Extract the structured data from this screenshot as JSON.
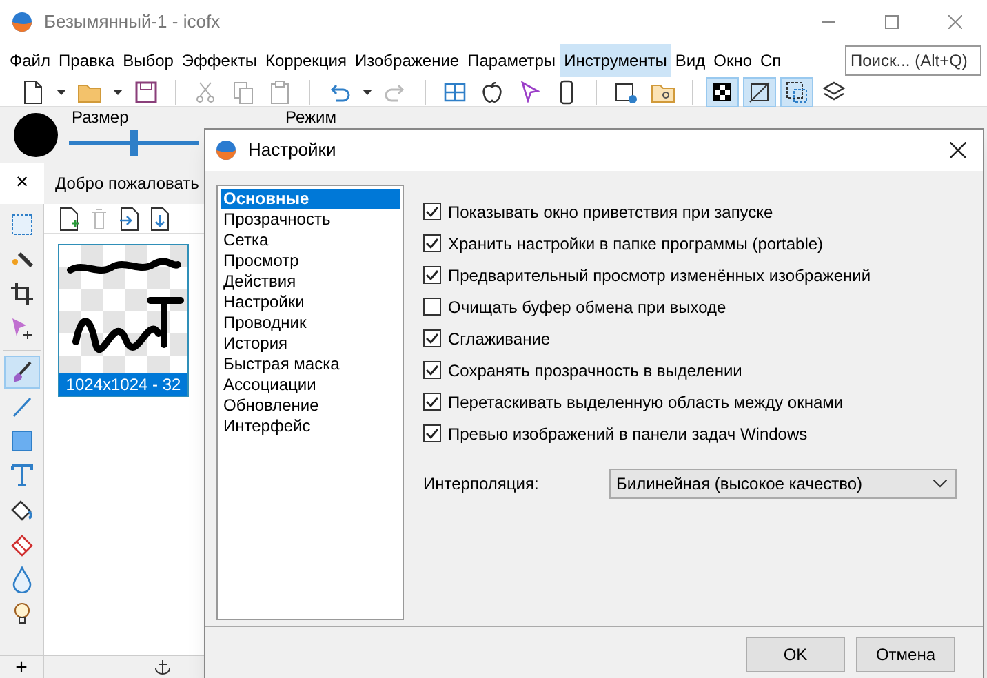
{
  "window": {
    "title": "Безымянный-1 - icofx"
  },
  "menu": [
    {
      "label": "Файл",
      "selected": false
    },
    {
      "label": "Правка",
      "selected": false
    },
    {
      "label": "Выбор",
      "selected": false
    },
    {
      "label": "Эффекты",
      "selected": false
    },
    {
      "label": "Коррекция",
      "selected": false
    },
    {
      "label": "Изображение",
      "selected": false
    },
    {
      "label": "Параметры",
      "selected": false
    },
    {
      "label": "Инструменты",
      "selected": true
    },
    {
      "label": "Вид",
      "selected": false
    },
    {
      "label": "Окно",
      "selected": false
    },
    {
      "label": "Сп",
      "selected": false
    }
  ],
  "search": {
    "placeholder": "Поиск... (Alt+Q)"
  },
  "toolbar": [
    {
      "buttons": [
        {
          "kind": "new",
          "on": false
        },
        {
          "kind": "caret",
          "on": false
        },
        {
          "kind": "open",
          "on": false
        },
        {
          "kind": "caret",
          "on": false
        },
        {
          "kind": "save",
          "on": false
        }
      ]
    },
    {
      "buttons": [
        {
          "kind": "cut",
          "on": false
        },
        {
          "kind": "copy",
          "on": false
        },
        {
          "kind": "paste",
          "on": false
        }
      ]
    },
    {
      "buttons": [
        {
          "kind": "undo",
          "on": false
        },
        {
          "kind": "caret",
          "on": false
        },
        {
          "kind": "redo",
          "on": false
        }
      ]
    },
    {
      "buttons": [
        {
          "kind": "windows",
          "on": false
        },
        {
          "kind": "apple",
          "on": false
        },
        {
          "kind": "cursor",
          "on": false
        },
        {
          "kind": "phone",
          "on": false
        }
      ]
    },
    {
      "buttons": [
        {
          "kind": "newdoc",
          "on": false
        },
        {
          "kind": "browse",
          "on": false
        }
      ]
    },
    {
      "buttons": [
        {
          "kind": "checker",
          "on": true
        },
        {
          "kind": "nocolor",
          "on": true
        },
        {
          "kind": "selection",
          "on": true
        },
        {
          "kind": "layers",
          "on": false
        }
      ]
    }
  ],
  "options": {
    "size_label": "Размер",
    "mode_label": "Режим",
    "size_slider": {
      "level": 0.5
    }
  },
  "tools": [
    {
      "buttons": [
        {
          "kind": "select",
          "selected": false
        },
        {
          "kind": "wand",
          "selected": false
        },
        {
          "kind": "crop",
          "selected": false
        },
        {
          "kind": "move",
          "selected": false
        }
      ]
    },
    {
      "buttons": [
        {
          "kind": "brush",
          "selected": true
        },
        {
          "kind": "line",
          "selected": false
        },
        {
          "kind": "rect",
          "selected": false
        },
        {
          "kind": "text",
          "selected": false
        },
        {
          "kind": "fill",
          "selected": false
        },
        {
          "kind": "eraser",
          "selected": false
        },
        {
          "kind": "drop",
          "selected": false
        },
        {
          "kind": "bulb",
          "selected": false
        }
      ]
    }
  ],
  "document_tab": {
    "close": "×",
    "label": "Добро пожаловать"
  },
  "documents": [
    {
      "caption": "1024x1024 - 32",
      "selected": true
    }
  ],
  "status_bar": {
    "add": "+"
  },
  "dialog": {
    "title": "Настройки",
    "categories": [
      {
        "label": "Основные",
        "selected": true
      },
      {
        "label": "Прозрачность",
        "selected": false
      },
      {
        "label": "Сетка",
        "selected": false
      },
      {
        "label": "Просмотр",
        "selected": false
      },
      {
        "label": "Действия",
        "selected": false
      },
      {
        "label": "Настройки",
        "selected": false
      },
      {
        "label": "Проводник",
        "selected": false
      },
      {
        "label": "История",
        "selected": false
      },
      {
        "label": "Быстрая маска",
        "selected": false
      },
      {
        "label": "Ассоциации",
        "selected": false
      },
      {
        "label": "Обновление",
        "selected": false
      },
      {
        "label": "Интерфейс",
        "selected": false
      }
    ],
    "options": [
      {
        "label": "Показывать окно приветствия при запуске",
        "checked": true
      },
      {
        "label": "Хранить настройки в папке программы (portable)",
        "checked": true
      },
      {
        "label": "Предварительный просмотр изменённых изображений",
        "checked": true
      },
      {
        "label": "Очищать буфер обмена при выходе",
        "checked": false
      },
      {
        "label": "Сглаживание",
        "checked": true
      },
      {
        "label": "Сохранять прозрачность в выделении",
        "checked": true
      },
      {
        "label": "Перетаскивать выделенную область между окнами",
        "checked": true
      },
      {
        "label": "Превью изображений в панели задач Windows",
        "checked": true
      }
    ],
    "interpolation": {
      "label": "Интерполяция:",
      "value": "Билинейная (высокое качество)"
    },
    "buttons": [
      "OK",
      "Отмена"
    ]
  }
}
